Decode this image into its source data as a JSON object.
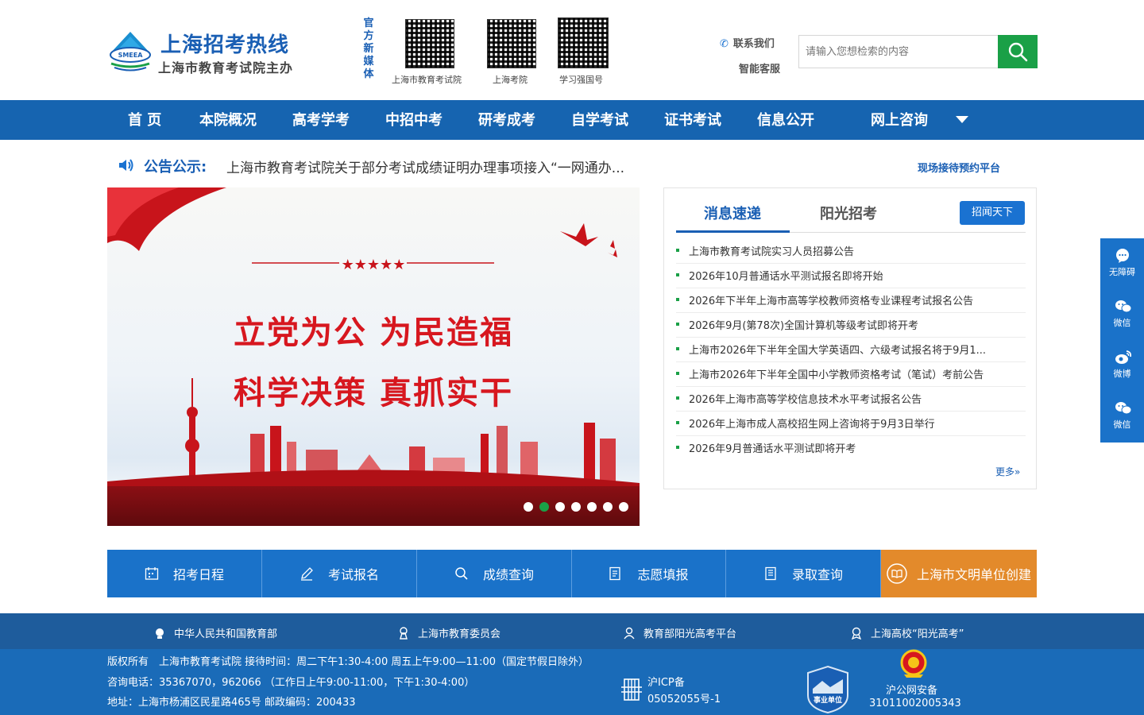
{
  "header": {
    "site_title": "上海招考热线",
    "site_subtitle": "上海市教育考试院主办",
    "logo_badge": "SMEEA",
    "media_label": [
      "官",
      "方",
      "新",
      "媒",
      "体"
    ],
    "qrcodes": [
      {
        "caption": "上海市教育考试院"
      },
      {
        "caption": "上海考院"
      },
      {
        "caption": "学习强国号"
      }
    ],
    "contact_label": "联系我们",
    "service_label": "智能客服",
    "search": {
      "placeholder": "请输入您想检索的内容"
    }
  },
  "nav": {
    "items": [
      "首 页",
      "本院概况",
      "高考学考",
      "中招中考",
      "研考成考",
      "自学考试",
      "证书考试",
      "信息公开",
      "网上咨询"
    ]
  },
  "notice": {
    "label": "公告公示:",
    "text": "上海市教育考试院关于部分考试成绩证明办理事项接入“一网通办...",
    "link": "现场接待预约平台"
  },
  "banner": {
    "line1": "立党为公  为民造福",
    "line2": "科学决策  真抓实干",
    "slide_count": 7,
    "active_slide": 2
  },
  "news": {
    "tabs": [
      "消息速递",
      "阳光招考"
    ],
    "pill": "招闻天下",
    "items": [
      "上海市教育考试院实习人员招募公告",
      "2026年10月普通话水平测试报名即将开始",
      "2026年下半年上海市高等学校教师资格专业课程考试报名公告",
      "2026年9月(第78次)全国计算机等级考试即将开考",
      "上海市2026年下半年全国大学英语四、六级考试报名将于9月1...",
      "上海市2026年下半年全国中小学教师资格考试（笔试）考前公告",
      "2026年上海市高等学校信息技术水平考试报名公告",
      "2026年上海市成人高校招生网上咨询将于9月3日举行",
      "2026年9月普通话水平测试即将开考"
    ],
    "more": "更多»"
  },
  "quick_links": [
    "招考日程",
    "考试报名",
    "成绩查询",
    "志愿填报",
    "录取查询",
    "上海市文明单位创建"
  ],
  "footer_links": [
    "中华人民共和国教育部",
    "上海市教育委员会",
    "教育部阳光高考平台",
    "上海高校“阳光高考”"
  ],
  "footer": {
    "line1": "版权所有　上海市教育考试院 接待时间：周二下午1:30-4:00 周五上午9:00—11:00（国定节假日除外）",
    "line2": "咨询电话：35367070，962066 （工作日上午9:00-11:00，下午1:30-4:00）",
    "line3": "地址：上海市杨浦区民星路465号 邮政编码：200433",
    "icp_label": "沪ICP备",
    "icp_number": "05052055号-1",
    "badge_text": "事业单位",
    "police_label": "沪公网安备",
    "police_number": "31011002005343"
  },
  "sidebar": [
    "无障碍",
    "微信",
    "微博",
    "微信"
  ],
  "colors": {
    "primary_blue": "#1664b0",
    "green": "#1aa047",
    "orange": "#e38a2b",
    "banner_red": "#d7171f"
  }
}
